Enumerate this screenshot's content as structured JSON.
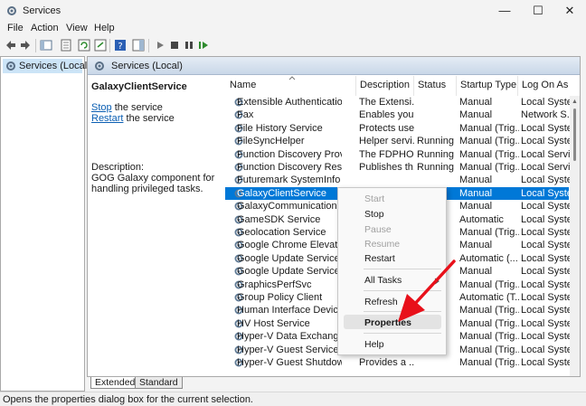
{
  "window": {
    "title": "Services",
    "controls": {
      "minimize": "—",
      "maximize": "☐",
      "close": "✕"
    }
  },
  "menu": [
    "File",
    "Action",
    "View",
    "Help"
  ],
  "tree": {
    "item": "Services (Local)"
  },
  "main_header": "Services (Local)",
  "left_panel": {
    "title": "GalaxyClientService",
    "stop_link": "Stop",
    "stop_suffix": " the service",
    "restart_link": "Restart",
    "restart_suffix": " the service",
    "description_label": "Description:",
    "description": "GOG Galaxy component for handling privileged tasks."
  },
  "columns": [
    "Name",
    "Description",
    "Status",
    "Startup Type",
    "Log On As"
  ],
  "rows": [
    [
      "Extensible Authentication P...",
      "The Extensi...",
      "",
      "Manual",
      "Local Syste..."
    ],
    [
      "Fax",
      "Enables you...",
      "",
      "Manual",
      "Network S..."
    ],
    [
      "File History Service",
      "Protects use...",
      "",
      "Manual (Trig...",
      "Local Syste..."
    ],
    [
      "FileSyncHelper",
      "Helper servi...",
      "Running",
      "Manual (Trig...",
      "Local Syste..."
    ],
    [
      "Function Discovery Provide...",
      "The FDPHO...",
      "Running",
      "Manual (Trig...",
      "Local Service"
    ],
    [
      "Function Discovery Resourc...",
      "Publishes th...",
      "Running",
      "Manual (Trig...",
      "Local Service"
    ],
    [
      "Futuremark SystemInfo Ser...",
      "",
      "",
      "Manual",
      "Local Syste..."
    ],
    [
      "GalaxyClientService",
      "",
      "",
      "Manual",
      "Local Syste..."
    ],
    [
      "GalaxyCommunication",
      "",
      "",
      "Manual",
      "Local Syste..."
    ],
    [
      "GameSDK Service",
      "",
      "",
      "Automatic",
      "Local Syste..."
    ],
    [
      "Geolocation Service",
      "",
      "",
      "Manual (Trig...",
      "Local Syste..."
    ],
    [
      "Google Chrome Elevation",
      "",
      "",
      "Manual",
      "Local Syste..."
    ],
    [
      "Google Update Service (g",
      "",
      "",
      "Automatic (...",
      "Local Syste..."
    ],
    [
      "Google Update Service (g",
      "",
      "",
      "Manual",
      "Local Syste..."
    ],
    [
      "GraphicsPerfSvc",
      "",
      "",
      "Manual (Trig...",
      "Local Syste..."
    ],
    [
      "Group Policy Client",
      "",
      "",
      "Automatic (T...",
      "Local Syste..."
    ],
    [
      "Human Interface Device S",
      "",
      "",
      "Manual (Trig...",
      "Local Syste..."
    ],
    [
      "HV Host Service",
      "",
      "",
      "Manual (Trig...",
      "Local Syste..."
    ],
    [
      "Hyper-V Data Exchange S",
      "",
      "",
      "Manual (Trig...",
      "Local Syste..."
    ],
    [
      "Hyper-V Guest Service Int",
      "",
      "",
      "Manual (Trig...",
      "Local Syste..."
    ],
    [
      "Hyper-V Guest Shutdown S...",
      "Provides a ...",
      "",
      "Manual (Trig...",
      "Local Syste..."
    ]
  ],
  "selected_row_index": 7,
  "context_menu": {
    "items": [
      {
        "label": "Start",
        "enabled": false
      },
      {
        "label": "Stop",
        "enabled": true
      },
      {
        "label": "Pause",
        "enabled": false
      },
      {
        "label": "Resume",
        "enabled": false
      },
      {
        "label": "Restart",
        "enabled": true
      },
      {
        "label": "All Tasks",
        "enabled": true
      },
      {
        "label": "Refresh",
        "enabled": true
      },
      {
        "label": "Properties",
        "enabled": true,
        "bold": true
      },
      {
        "label": "Help",
        "enabled": true
      }
    ]
  },
  "tabs": [
    "Extended",
    "Standard"
  ],
  "status_bar": "Opens the properties dialog box for the current selection.",
  "colors": {
    "selection": "#0078d7",
    "arrow": "#e8101a",
    "link": "#0b5fb3"
  }
}
